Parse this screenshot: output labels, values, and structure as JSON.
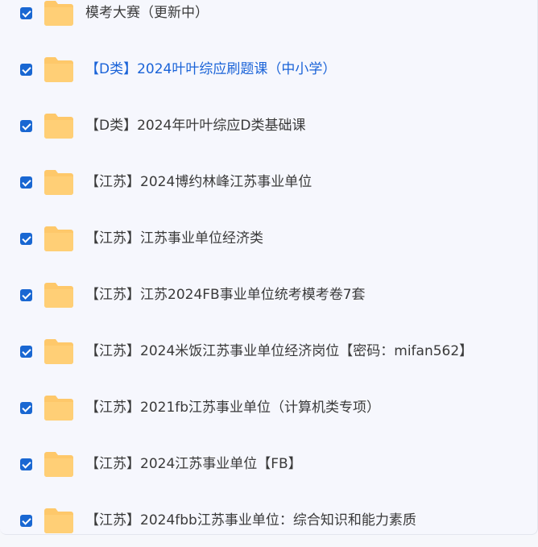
{
  "colors": {
    "accent": "#1a63d8",
    "checkbox": "#1967d2",
    "folder": "#fec86a",
    "text": "#3a3a3a"
  },
  "items": [
    {
      "label": "模考大赛（更新中）",
      "checked": true,
      "icon": "folder-icon",
      "active": false
    },
    {
      "label": "【D类】2024叶叶综应刷题课（中小学）",
      "checked": true,
      "icon": "folder-icon",
      "active": true
    },
    {
      "label": "【D类】2024年叶叶综应D类基础课",
      "checked": true,
      "icon": "folder-icon",
      "active": false
    },
    {
      "label": "【江苏】2024博约林峰江苏事业单位",
      "checked": true,
      "icon": "folder-icon",
      "active": false
    },
    {
      "label": "【江苏】江苏事业单位经济类",
      "checked": true,
      "icon": "folder-icon",
      "active": false
    },
    {
      "label": "【江苏】江苏2024FB事业单位统考模考卷7套",
      "checked": true,
      "icon": "folder-icon",
      "active": false
    },
    {
      "label": "【江苏】2024米饭江苏事业单位经济岗位【密码：mifan562】",
      "checked": true,
      "icon": "folder-icon",
      "active": false
    },
    {
      "label": "【江苏】2021fb江苏事业单位（计算机类专项）",
      "checked": true,
      "icon": "folder-icon",
      "active": false
    },
    {
      "label": "【江苏】2024江苏事业单位【FB】",
      "checked": true,
      "icon": "folder-icon",
      "active": false
    },
    {
      "label": "【江苏】2024fbb江苏事业单位：综合知识和能力素质",
      "checked": true,
      "icon": "folder-icon",
      "active": false
    }
  ]
}
